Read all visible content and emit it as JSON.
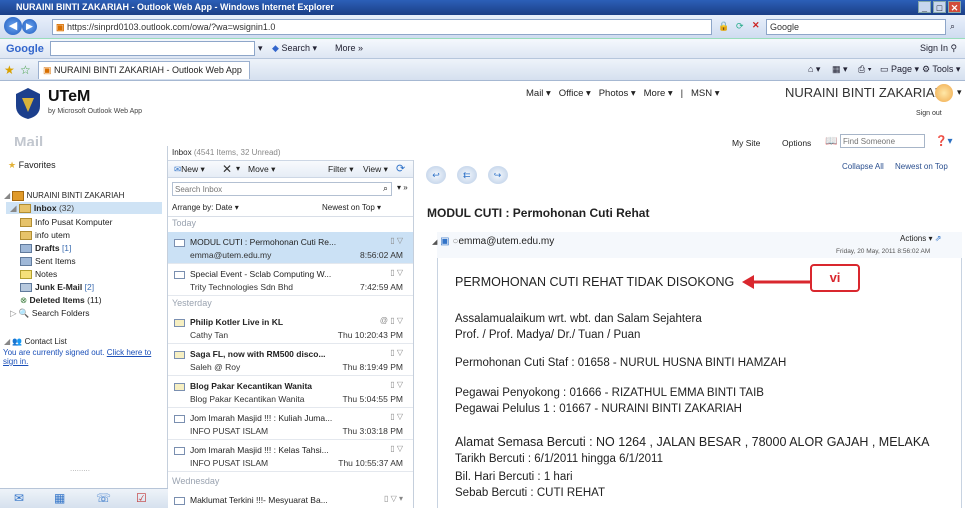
{
  "browser": {
    "title": "NURAINI BINTI ZAKARIAH - Outlook Web App - Windows Internet Explorer",
    "url": "https://sinprd0103.outlook.com/owa/?wa=wsignin1.0",
    "search_value": "Google",
    "google_label": "Google",
    "google_search_label": "Search",
    "google_more_label": "More",
    "sign_in_label": "Sign In",
    "tab_label": "NURAINI BINTI ZAKARIAH - Outlook Web App",
    "page_label": "Page",
    "tools_label": "Tools"
  },
  "owa": {
    "logo": "UTeM",
    "logo_sub": "by Microsoft Outlook Web App",
    "topnav": [
      "Mail",
      "Office",
      "Photos",
      "More",
      "|",
      "MSN"
    ],
    "user_name": "NURAINI BINTI ZAKARIAH",
    "sign_out": "Sign out",
    "my_site": "My Site",
    "options": "Options",
    "find_someone_placeholder": "Find Someone",
    "section_title": "Mail"
  },
  "sidebar": {
    "favorites": "Favorites",
    "mailbox": "NURAINI BINTI ZAKARIAH",
    "folders": [
      {
        "name": "Inbox",
        "count": "(32)"
      },
      {
        "name": "Info Pusat Komputer",
        "count": ""
      },
      {
        "name": "info utem",
        "count": ""
      },
      {
        "name": "Drafts",
        "count": "[1]"
      },
      {
        "name": "Sent Items",
        "count": ""
      },
      {
        "name": "Notes",
        "count": ""
      },
      {
        "name": "Junk E-Mail",
        "count": "[2]"
      },
      {
        "name": "Deleted Items",
        "count": "(11)"
      },
      {
        "name": "Search Folders",
        "count": ""
      }
    ],
    "contact_list": "Contact List",
    "signed_out_msg": "You are currently signed out.",
    "click_here": "Click here to sign in."
  },
  "list": {
    "header": "Inbox",
    "header_count": "(4541 Items, 32 Unread)",
    "new": "New",
    "move": "Move",
    "filter": "Filter",
    "view": "View",
    "search_placeholder": "Search Inbox",
    "arrange": "Arrange by: Date",
    "sort": "Newest on Top",
    "groups": [
      "Today",
      "Yesterday",
      "Wednesday"
    ],
    "messages": [
      {
        "subject": "MODUL CUTI : Permohonan Cuti Re...",
        "from": "emma@utem.edu.my",
        "time": "8:56:02 AM"
      },
      {
        "subject": "Special Event - Sclab Computing W...",
        "from": "Trity Technologies Sdn Bhd",
        "time": "7:42:59 AM"
      },
      {
        "subject": "Philip Kotler Live in KL",
        "from": "Cathy Tan",
        "time": "Thu 10:20:43 PM"
      },
      {
        "subject": "Saga FL, now with RM500 disco...",
        "from": "Saleh @ Roy",
        "time": "Thu 8:19:49 PM"
      },
      {
        "subject": "Blog Pakar Kecantikan Wanita",
        "from": "Blog Pakar Kecantikan Wanita",
        "time": "Thu 5:04:55 PM"
      },
      {
        "subject": "Jom Imarah Masjid !!! : Kuliah Juma...",
        "from": "INFO PUSAT ISLAM",
        "time": "Thu 3:03:18 PM"
      },
      {
        "subject": "Jom Imarah Masjid !!! : Kelas Tahsi...",
        "from": "INFO PUSAT ISLAM",
        "time": "Thu 10:55:37 AM"
      },
      {
        "subject": "Maklumat Terkini !!!- Mesyuarat Ba...",
        "from": "",
        "time": ""
      }
    ]
  },
  "reading": {
    "collapse": "Collapse All",
    "newest": "Newest on Top",
    "subject": "MODUL CUTI : Permohonan Cuti Rehat",
    "sender": "emma@utem.edu.my",
    "actions": "Actions",
    "date": "Friday, 20 May, 2011 8:56:02 AM",
    "heading": "PERMOHONAN CUTI REHAT TIDAK DISOKONG",
    "callout": "vi",
    "greeting1": "Assalamualaikum wrt. wbt. dan Salam Sejahtera",
    "greeting2": "Prof. / Prof. Madya/ Dr./ Tuan / Puan",
    "staff_label": "Permohonan Cuti Staf : ",
    "staff_value": "01658 - NURUL HUSNA BINTI HAMZAH",
    "supporter_label": "Pegawai Penyokong : ",
    "supporter_value": "01666 - RIZATHUL EMMA BINTI TAIB",
    "approver_label": "Pegawai Pelulus 1 : ",
    "approver_value": "01667 - NURAINI BINTI ZAKARIAH",
    "address_label": "Alamat Semasa Bercuti : ",
    "address_value": "NO 1264 , JALAN BESAR , 78000 ALOR GAJAH , MELAKA",
    "date_label": "Tarikh Bercuti : ",
    "date_value": "6/1/2011 hingga 6/1/2011",
    "days_label": "Bil. Hari Bercuti : ",
    "days_value": "1 hari",
    "reason_label": "Sebab Bercuti : ",
    "reason_value": "CUTI REHAT"
  }
}
